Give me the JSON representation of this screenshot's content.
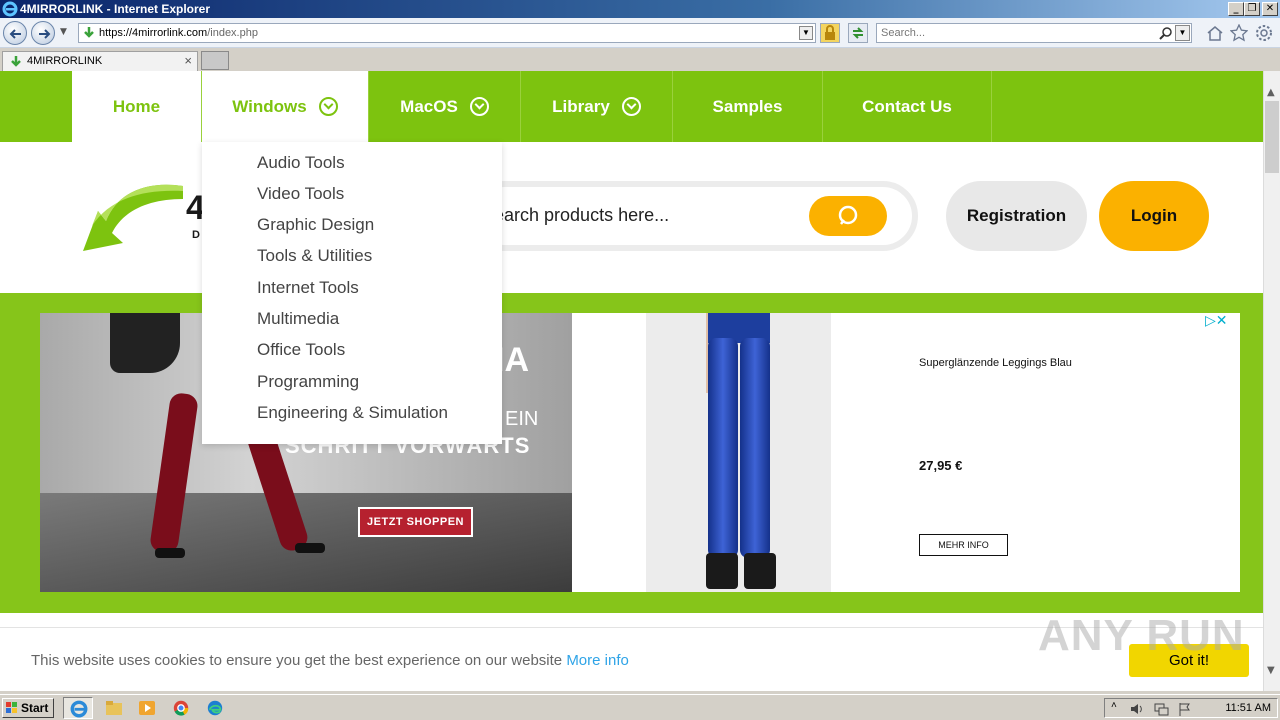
{
  "window": {
    "title": "4MIRRORLINK - Internet Explorer",
    "min": "_",
    "restore": "❐",
    "close": "✕"
  },
  "browser": {
    "url_host": "https://4mirrorlink.com",
    "url_path": "/index.php",
    "search_placeholder": "Search...",
    "tab_label": "4MIRRORLINK",
    "tab_close": "×"
  },
  "site": {
    "nav": [
      {
        "label": "Home",
        "active": false,
        "dropdown": false
      },
      {
        "label": "Windows",
        "active": true,
        "dropdown": true
      },
      {
        "label": "MacOS",
        "active": false,
        "dropdown": true
      },
      {
        "label": "Library",
        "active": false,
        "dropdown": true
      },
      {
        "label": "Samples",
        "active": false,
        "dropdown": false
      },
      {
        "label": "Contact Us",
        "active": false,
        "dropdown": false
      }
    ],
    "logo_text": "4",
    "logo_sub": "D",
    "search_placeholder": "earch products here...",
    "registration": "Registration",
    "login": "Login",
    "dropdown_items": [
      "Audio Tools",
      "Video Tools",
      "Graphic Design",
      "Tools & Utilities",
      "Internet Tools",
      "Multimedia",
      "Office Tools",
      "Programming",
      "Engineering & Simulation"
    ],
    "colors": {
      "green": "#7dc30f",
      "yellow": "#fbb100"
    }
  },
  "ad": {
    "headline": "IA",
    "line1": "EIN",
    "line2": "SCHRITT VORWÄRTS",
    "shop": "JETZT SHOPPEN",
    "product_name": "Superglänzende Leggings Blau",
    "price": "27,95 €",
    "more": "MEHR INFO",
    "icons": "▷✕"
  },
  "cookie": {
    "message": "This website uses cookies to ensure you get the best experience on our website",
    "more": "More info",
    "button": "Got it!"
  },
  "watermark": "ANY RUN",
  "taskbar": {
    "start": "Start",
    "clock": "11:51 AM"
  }
}
